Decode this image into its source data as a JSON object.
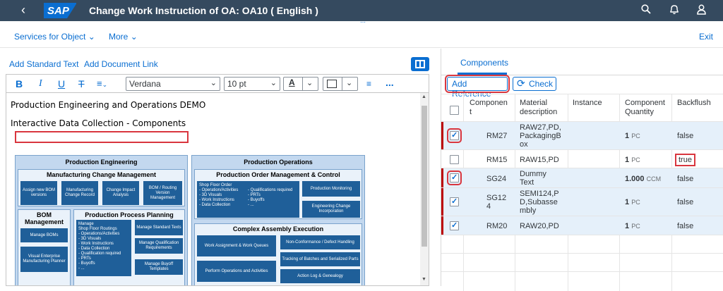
{
  "shell": {
    "logo": "SAP",
    "title": "Change Work Instruction of OA: OA10 ( English )",
    "icons": [
      "back-icon",
      "search-icon",
      "bell-icon",
      "user-icon"
    ]
  },
  "subheader": {
    "services": "Services for Object",
    "more": "More",
    "exit": "Exit"
  },
  "editor": {
    "add_standard_text": "Add Standard Text",
    "add_document_link": "Add Document Link",
    "toolbar": {
      "bold": "B",
      "italic": "I",
      "underline": "U",
      "strike": "T",
      "font": "Verdana",
      "size": "10 pt",
      "text_color": "A",
      "more": "..."
    },
    "lines": [
      "Production Engineering and Operations DEMO",
      "Interactive Data Collection - Components"
    ]
  },
  "diagram": {
    "pe_title": "Production Engineering",
    "mcm_title": "Manufacturing Change Management",
    "mcm_tiles": [
      "Assign new BOM versions",
      "Manufacturing Change Record",
      "Change Impact Analysis",
      "BOM / Routing Version Management"
    ],
    "bom_title": "BOM Management",
    "bom_tiles": [
      "Manage BOMs",
      "Visual Enterprise Manufacturing Planner"
    ],
    "ppp_title": "Production Process Planning",
    "ppp_list": [
      "Manage",
      "Shop Floor Routings",
      "- Operations/Activities",
      "- 3D Visuals",
      "- Work Instructions",
      "- Data Collection",
      "- Qualification required",
      "- PRTs",
      "- Buyoffs",
      "- ..."
    ],
    "ppp_tiles": [
      "Manage Standard Texts",
      "Manage Qualification Requirements",
      "Manage Buyoff Templates"
    ],
    "po_title": "Production Operations",
    "pomc_title": "Production Order Management & Control",
    "sfo_list": [
      "Shop Floor Order",
      "- Operation/Activities",
      "- 3D Visuals",
      "- Work Instructions",
      "- Data Collection"
    ],
    "sfo_list2": [
      "- Qualifications required",
      "- PRTs",
      "- Buyoffs",
      "- ..."
    ],
    "pomc_tiles": [
      "Production Monitoring",
      "Engineering Change Incorporation"
    ],
    "cae_title": "Complex Assembly Execution",
    "cae_tiles": [
      "Work Assignment & Work Queues",
      "Non-Conformance / Defect Handling",
      "Tracking of Batches and Serialized Parts",
      "Perform Operations and Activities",
      "Action Log & Genealogy"
    ]
  },
  "components": {
    "tab": "Components",
    "add_reference": "Add Reference",
    "check": "Check",
    "columns": [
      "Component",
      "Material description",
      "Instance",
      "Component Quantity",
      "Backflush"
    ],
    "rows": [
      {
        "checked": true,
        "component": "RM27",
        "description": "RAW27,PD, PackagingBox",
        "instance": "",
        "quantity": "1",
        "unit": "PC",
        "backflush": "false"
      },
      {
        "checked": false,
        "component": "RM15",
        "description": "RAW15,PD",
        "instance": "",
        "quantity": "1",
        "unit": "PC",
        "backflush": "true"
      },
      {
        "checked": true,
        "component": "SG24",
        "description": "Dummy Text",
        "instance": "",
        "quantity": "1.000",
        "unit": "CCM",
        "backflush": "false"
      },
      {
        "checked": true,
        "component": "SG124",
        "description": "SEMI124,PD,Subassembly",
        "instance": "",
        "quantity": "1",
        "unit": "PC",
        "backflush": "false"
      },
      {
        "checked": true,
        "component": "RM20",
        "description": "RAW20,PD",
        "instance": "",
        "quantity": "1",
        "unit": "PC",
        "backflush": "false"
      }
    ]
  },
  "colors": {
    "shell": "#354a5f",
    "accent": "#0a6ed1",
    "highlight": "#d9363e",
    "diagram_tile": "#1f5f99"
  }
}
